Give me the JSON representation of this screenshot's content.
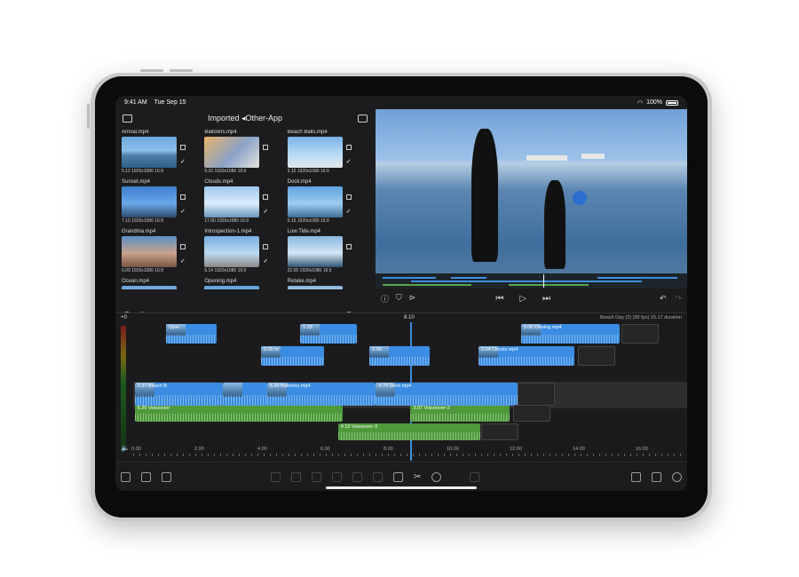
{
  "status": {
    "time": "9:41 AM",
    "date": "Tue Sep 15",
    "battery": "100%"
  },
  "browser": {
    "title": "Imported ◂Other-App",
    "clips": [
      {
        "name": "Arrival.mp4",
        "duration": "5.12",
        "res": "1920x1080",
        "aspect": "16:9",
        "checked": true,
        "thumb": "th1"
      },
      {
        "name": "Balloons.mp4",
        "duration": "9.20",
        "res": "1920x1080",
        "aspect": "16:9",
        "checked": false,
        "thumb": "th2"
      },
      {
        "name": "Beach Balls.mp4",
        "duration": "3.12",
        "res": "1920x1080",
        "aspect": "16:9",
        "checked": true,
        "thumb": "th3"
      },
      {
        "name": "Sunset.mp4",
        "duration": "7.10",
        "res": "1920x1080",
        "aspect": "16:9",
        "checked": true,
        "thumb": "th4"
      },
      {
        "name": "Clouds.mp4",
        "duration": "17.00",
        "res": "1920x1080",
        "aspect": "16:9",
        "checked": true,
        "thumb": "th5"
      },
      {
        "name": "Dock.mp4",
        "duration": "5.16",
        "res": "1920x1080",
        "aspect": "16:9",
        "checked": true,
        "thumb": "th6"
      },
      {
        "name": "Grandma.mp4",
        "duration": "6.09",
        "res": "1920x1080",
        "aspect": "16:9",
        "checked": true,
        "thumb": "th7"
      },
      {
        "name": "Introspection-1.mp4",
        "duration": "6.14",
        "res": "1920x1080",
        "aspect": "16:9",
        "checked": true,
        "thumb": "th8"
      },
      {
        "name": "Low Tide.mp4",
        "duration": "22.05",
        "res": "1920x1080",
        "aspect": "16:9",
        "checked": false,
        "thumb": "th9"
      },
      {
        "name": "Ocean.mp4",
        "duration": "",
        "res": "",
        "aspect": "",
        "checked": false,
        "thumb": "th1"
      },
      {
        "name": "Opening.mp4",
        "duration": "",
        "res": "",
        "aspect": "",
        "checked": false,
        "thumb": "th6"
      },
      {
        "name": "Retake.mp4",
        "duration": "",
        "res": "",
        "aspect": "",
        "checked": false,
        "thumb": "th9"
      }
    ]
  },
  "timeline": {
    "zero_label": "+0",
    "timecode": "8.10",
    "clip_info": "Beach Day (2) (30 fps)   15.17 duration",
    "connected_clips": [
      {
        "label": "Oper",
        "type": "video",
        "row": 0,
        "start": 1.05,
        "dur": 1.6
      },
      {
        "label": "1.28",
        "type": "video",
        "row": 0,
        "start": 5.3,
        "dur": 1.8
      },
      {
        "label": "3.06  Closing.mp4",
        "type": "video",
        "row": 0,
        "start": 12.3,
        "dur": 3.15
      },
      {
        "label": "2.05  In",
        "type": "video",
        "row": 1,
        "start": 4.05,
        "dur": 2.0
      },
      {
        "label": "2.00",
        "type": "video",
        "row": 1,
        "start": 7.5,
        "dur": 1.9
      },
      {
        "label": "3.04  Clouds.mp4",
        "type": "video",
        "row": 1,
        "start": 10.95,
        "dur": 3.05
      },
      {
        "label": "6.20  Voiceover",
        "type": "audio",
        "row": 3,
        "start": 0.05,
        "dur": 6.6
      },
      {
        "label": "3.07  Voiceover-2",
        "type": "audio",
        "row": 3,
        "start": 8.8,
        "dur": 3.15
      },
      {
        "label": "4.13  Voiceover-3",
        "type": "audio",
        "row": 4,
        "start": 6.5,
        "dur": 4.5
      }
    ],
    "primary_clips": [
      {
        "label": "2.27  Beach B",
        "start": 0.05,
        "dur": 2.8
      },
      {
        "label": "",
        "start": 2.85,
        "dur": 1.4
      },
      {
        "label": "6.20  Balloons.mp4",
        "start": 4.25,
        "dur": 3.45
      },
      {
        "label": "4.70  Dock.mp4",
        "start": 7.7,
        "dur": 4.5
      }
    ],
    "ruler": [
      "0.00",
      "2.00",
      "4.00",
      "6.00",
      "8.00",
      "10.00",
      "12.00",
      "14.00",
      "16.00"
    ]
  },
  "icons": {
    "browser": [
      "folder-icon",
      "download-icon",
      "checkmark-icon",
      "record-icon",
      "trash-icon",
      "search-icon",
      "filter-icon"
    ],
    "viewer": [
      "info-icon",
      "shield-icon",
      "add-marker-icon",
      "skip-back-icon",
      "play-icon",
      "skip-forward-icon",
      "undo-icon",
      "redo-icon"
    ],
    "bottom": [
      "export-icon",
      "project-icon",
      "options-icon",
      "split-icon",
      "scissors-icon",
      "add-icon",
      "layout-icon",
      "share-icon",
      "settings-icon"
    ]
  },
  "colors": {
    "video_clip": "#3b8de3",
    "audio_clip": "#4e9a3a",
    "background": "#1c1c1e",
    "playhead": "#3b8de3"
  }
}
